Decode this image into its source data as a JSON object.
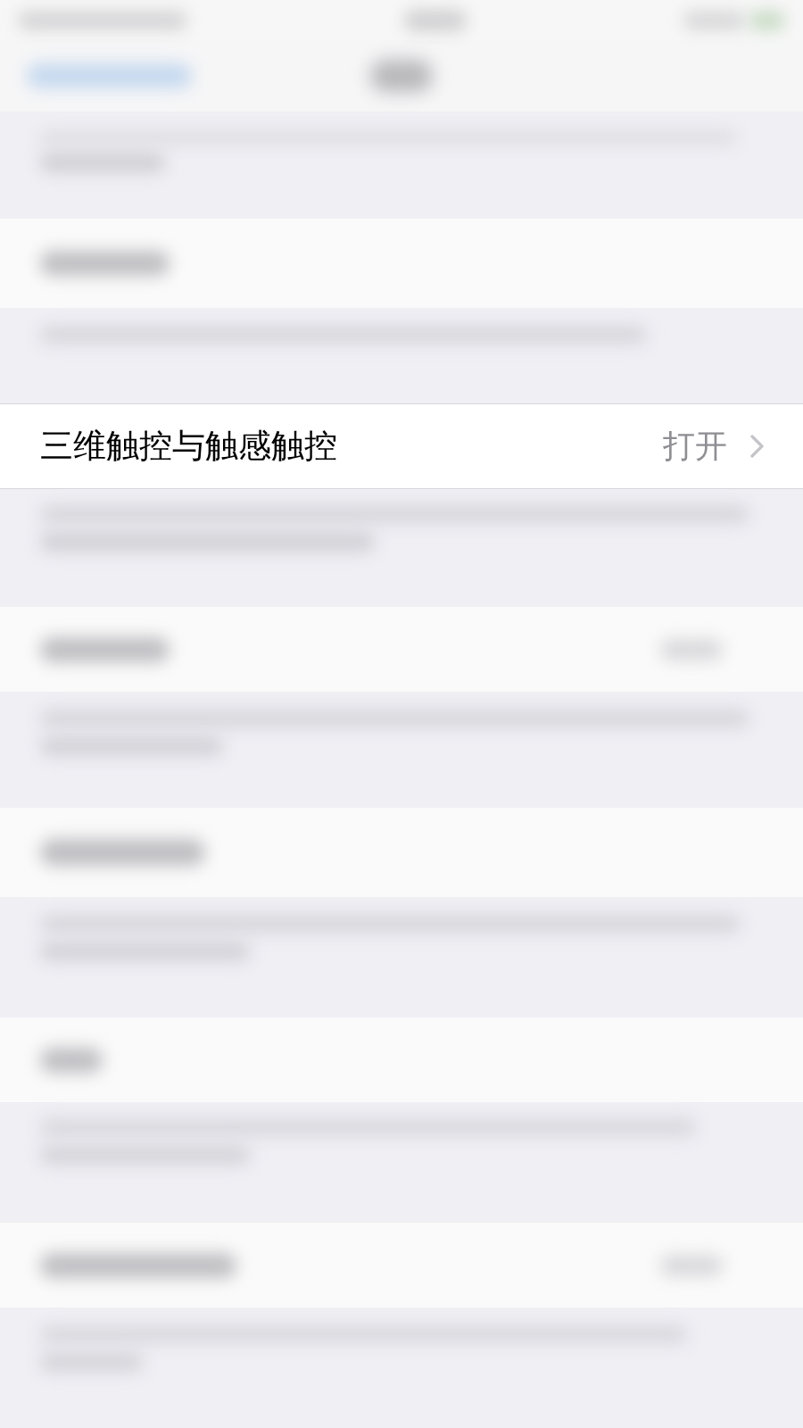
{
  "status_bar": {
    "kind": "blurred"
  },
  "navigation_bar": {
    "kind": "blurred"
  },
  "rows": [
    {
      "kind": "blurred-footnote"
    },
    {
      "kind": "blurred-cell"
    },
    {
      "kind": "blurred-footnote"
    },
    {
      "kind": "cell",
      "label": "三维触控与触感触控",
      "value": "打开"
    },
    {
      "kind": "blurred-footnote"
    },
    {
      "kind": "blurred-cell"
    },
    {
      "kind": "blurred-footnote"
    },
    {
      "kind": "blurred-cell"
    },
    {
      "kind": "blurred-footnote"
    },
    {
      "kind": "blurred-cell"
    },
    {
      "kind": "blurred-footnote"
    },
    {
      "kind": "blurred-cell"
    },
    {
      "kind": "blurred-footnote"
    }
  ]
}
